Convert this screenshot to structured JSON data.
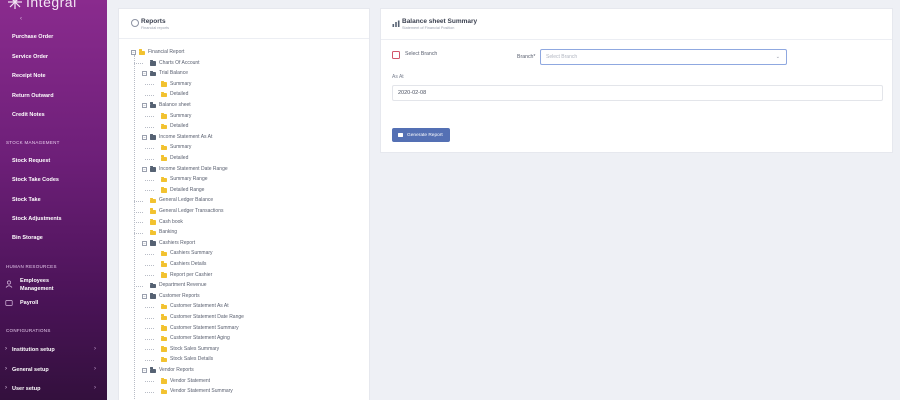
{
  "app": {
    "logo_text": "Integral"
  },
  "sidebar": {
    "items": [
      {
        "label": "Purchase Order"
      },
      {
        "label": "Service Order"
      },
      {
        "label": "Receipt Note"
      },
      {
        "label": "Return Outward"
      },
      {
        "label": "Credit Notes"
      }
    ],
    "section_stock": "STOCK MANAGEMENT",
    "stock_items": [
      {
        "label": "Stock Request"
      },
      {
        "label": "Stock Take Codes"
      },
      {
        "label": "Stock Take"
      },
      {
        "label": "Stock Adjustments"
      },
      {
        "label": "Bin Storage"
      }
    ],
    "section_hr": "HUMAN RESOURCES",
    "hr_items": [
      {
        "label_line1": "Employees",
        "label_line2": "Management"
      },
      {
        "label_line1": "Payroll",
        "label_line2": ""
      }
    ],
    "section_config": "CONFIGURATIONS",
    "config_items": [
      {
        "label": "Institution setup"
      },
      {
        "label": "General setup"
      },
      {
        "label": "User setup"
      }
    ]
  },
  "reports_panel": {
    "title": "Reports",
    "subtitle": "Financial reports",
    "tree": [
      {
        "label": "Financial Report"
      },
      {
        "label": "Charts Of Account"
      },
      {
        "label": "Trial Balance"
      },
      {
        "label": "Summary"
      },
      {
        "label": "Detailed"
      },
      {
        "label": "Balance sheet"
      },
      {
        "label": "Summary"
      },
      {
        "label": "Detailed"
      },
      {
        "label": "Income Statement As At"
      },
      {
        "label": "Summary"
      },
      {
        "label": "Detailed"
      },
      {
        "label": "Income Statement Date Range"
      },
      {
        "label": "Summary Range"
      },
      {
        "label": "Detailed Range"
      },
      {
        "label": "General Ledger Balance"
      },
      {
        "label": "General Ledger Transactions"
      },
      {
        "label": "Cash book"
      },
      {
        "label": "Banking"
      },
      {
        "label": "Cashiers Report"
      },
      {
        "label": "Cashiers Summary"
      },
      {
        "label": "Cashiers Details"
      },
      {
        "label": "Report per Cashier"
      },
      {
        "label": "Department Revenue"
      },
      {
        "label": "Customer Reports"
      },
      {
        "label": "Customer Statement As At"
      },
      {
        "label": "Customer Statement Date Range"
      },
      {
        "label": "Customer Statement Summary"
      },
      {
        "label": "Customer Statement Aging"
      },
      {
        "label": "Stock Sales Summary"
      },
      {
        "label": "Stock Sales Details"
      },
      {
        "label": "Vendor Reports"
      },
      {
        "label": "Vendor Statement"
      },
      {
        "label": "Vendor Statement Summary"
      }
    ]
  },
  "summary_panel": {
    "title": "Balance sheet Summary",
    "subtitle": "Statement of Financial Position",
    "select_branch_label": "Select Branch",
    "branch_label": "Branch*",
    "branch_placeholder": "Select Branch",
    "as_at_label": "As At",
    "as_at_value": "2020-02-08",
    "generate_button": "Generate Report"
  },
  "colors": {
    "sidebar_top": "#8a2b8e",
    "sidebar_bottom": "#33103d",
    "folder": "#f2c230",
    "primary_button": "#5470b4",
    "checkbox_border": "#d2556a"
  }
}
